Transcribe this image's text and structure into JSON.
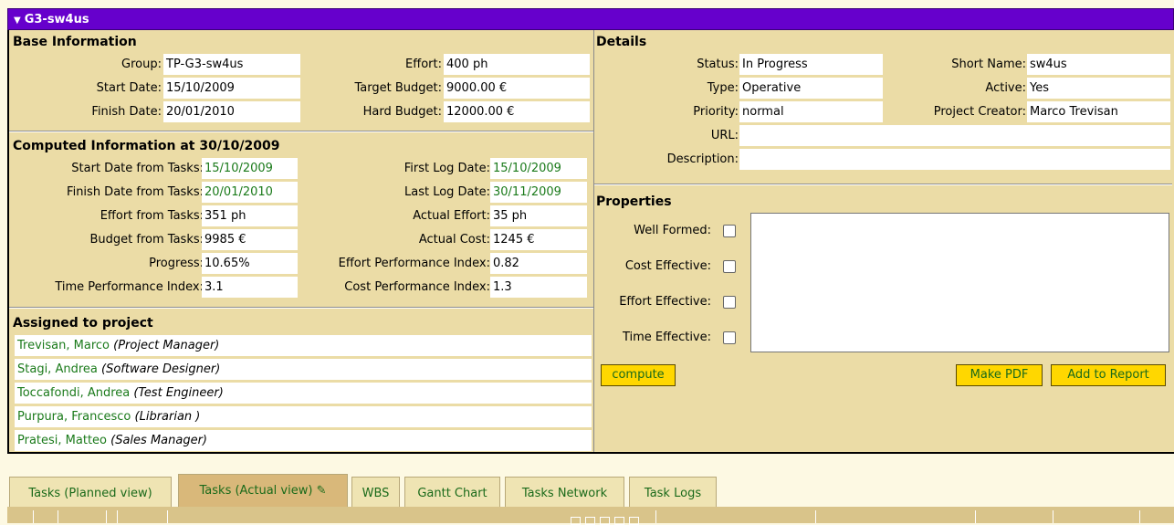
{
  "window": {
    "title": "G3-sw4us"
  },
  "base": {
    "heading": "Base Information",
    "group_label": "Group:",
    "group": "TP-G3-sw4us",
    "start_label": "Start Date:",
    "start": "15/10/2009",
    "finish_label": "Finish Date:",
    "finish": "20/01/2010",
    "effort_label": "Effort:",
    "effort": "400 ph",
    "target_label": "Target Budget:",
    "target": "9000.00 €",
    "hard_label": "Hard Budget:",
    "hard": "12000.00 €"
  },
  "computed": {
    "heading": "Computed Information at 30/10/2009",
    "rows": [
      {
        "l1": "Start Date from Tasks:",
        "v1": "15/10/2009",
        "l2": "First Log Date:",
        "v2": "15/10/2009"
      },
      {
        "l1": "Finish Date from Tasks:",
        "v1": "20/01/2010",
        "l2": "Last Log Date:",
        "v2": "30/11/2009"
      },
      {
        "l1": "Effort from Tasks:",
        "v1": "351 ph",
        "l2": "Actual Effort:",
        "v2": "35 ph"
      },
      {
        "l1": "Budget from Tasks:",
        "v1": "9985 €",
        "l2": "Actual Cost:",
        "v2": "1245 €"
      },
      {
        "l1": "Progress:",
        "v1": "10.65%",
        "l2": "Effort Performance Index:",
        "v2": "0.82"
      },
      {
        "l1": "Time Performance Index:",
        "v1": "3.1",
        "l2": "Cost Performance Index:",
        "v2": "1.3"
      }
    ]
  },
  "assigned": {
    "heading": "Assigned to project",
    "people": [
      {
        "name": "Trevisan, Marco",
        "role": "(Project Manager)"
      },
      {
        "name": "Stagi, Andrea",
        "role": "(Software Designer)"
      },
      {
        "name": "Toccafondi, Andrea",
        "role": "(Test Engineer)"
      },
      {
        "name": "Purpura, Francesco",
        "role": "(Librarian )"
      },
      {
        "name": "Pratesi, Matteo",
        "role": "(Sales Manager)"
      }
    ]
  },
  "details": {
    "heading": "Details",
    "status_label": "Status:",
    "status": "In Progress",
    "type_label": "Type:",
    "type": "Operative",
    "priority_label": "Priority:",
    "priority": "normal",
    "short_label": "Short Name:",
    "short": "sw4us",
    "active_label": "Active:",
    "active": "Yes",
    "creator_label": "Project Creator:",
    "creator": "Marco Trevisan",
    "url_label": "URL:",
    "url": "",
    "desc_label": "Description:",
    "desc": ""
  },
  "properties": {
    "heading": "Properties",
    "well_formed": "Well Formed:",
    "cost_effective": "Cost Effective:",
    "effort_effective": "Effort Effective:",
    "time_effective": "Time Effective:",
    "compute": "compute",
    "make_pdf": "Make PDF",
    "add_report": "Add to Report"
  },
  "tabs": [
    {
      "label": "Tasks (Planned view)"
    },
    {
      "label": "Tasks (Actual view)"
    },
    {
      "label": "WBS"
    },
    {
      "label": "Gantt Chart"
    },
    {
      "label": "Tasks Network"
    },
    {
      "label": "Task Logs"
    }
  ],
  "icons": {
    "collapse": "collapse-triangle-icon",
    "edit": "pencil-icon"
  },
  "colors": {
    "titlebar": "#6600cc",
    "panel": "#ebdca6",
    "button": "#ffd700",
    "link": "#1a7a1a"
  }
}
